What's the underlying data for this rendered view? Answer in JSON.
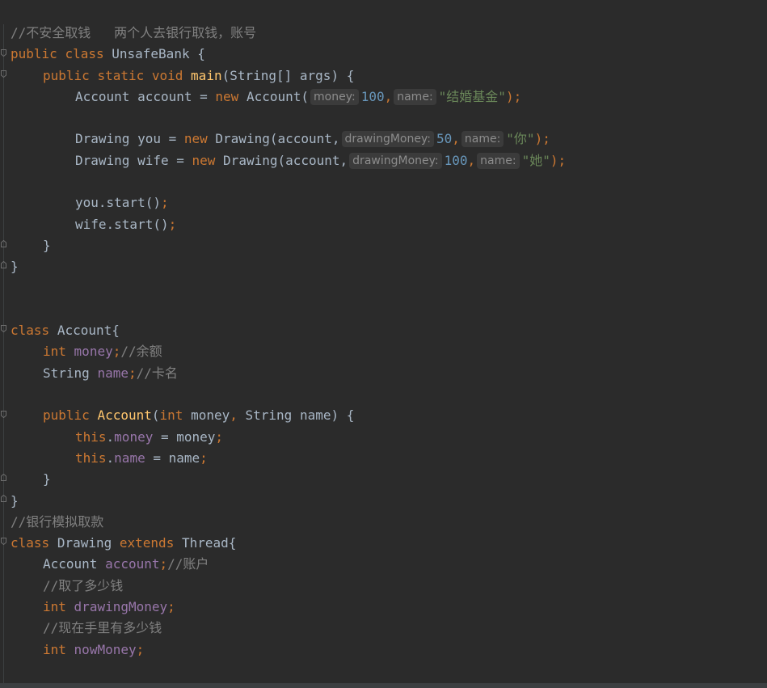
{
  "editor": {
    "l1": {
      "comment": "//不安全取钱   两个人去银行取钱，账号"
    },
    "l2": {
      "kw_public": "public",
      "kw_class": "class",
      "class_name": "UnsafeBank",
      "brace": "{"
    },
    "l3": {
      "kw_public": "public",
      "kw_static": "static",
      "kw_void": "void",
      "method": "main",
      "params": "(String[] args) {"
    },
    "l4": {
      "left": "Account account = ",
      "kw_new": "new",
      "ctor": "Account(",
      "hint_money": "money:",
      "money": "100",
      "comma": ",",
      "hint_name": "name:",
      "name": "\"结婚基金\"",
      "end": ");"
    },
    "l6": {
      "left": "Drawing you = ",
      "kw_new": "new",
      "ctor": "Drawing(account,",
      "hint_drawing": "drawingMoney:",
      "drawing": "50",
      "comma": ",",
      "hint_name": "name:",
      "name": "\"你\"",
      "end": ");"
    },
    "l7": {
      "left": "Drawing wife = ",
      "kw_new": "new",
      "ctor": "Drawing(account,",
      "hint_drawing": "drawingMoney:",
      "drawing": "100",
      "comma": ",",
      "hint_name": "name:",
      "name": "\"她\"",
      "end": ");"
    },
    "l9": {
      "text": "you.start()",
      "semi": ";"
    },
    "l10": {
      "text": "wife.start()",
      "semi": ";"
    },
    "l11": {
      "text": "}"
    },
    "l12": {
      "text": "}"
    },
    "l15": {
      "kw_class": "class",
      "text": "Account{"
    },
    "l16": {
      "kw_int": "int",
      "field": "money",
      "semi": ";",
      "comment": "//余额"
    },
    "l17": {
      "type": "String",
      "field": "name",
      "semi": ";",
      "comment": "//卡名"
    },
    "l19": {
      "kw_public": "public",
      "ctor": "Account",
      "p_open": "(",
      "kw_int": "int",
      "p_money": "money",
      "comma": ",",
      "p_rest": "String name) {"
    },
    "l20": {
      "kw_this": "this",
      "dot": ".",
      "field": "money",
      "rest": " = money",
      "semi": ";"
    },
    "l21": {
      "kw_this": "this",
      "dot": ".",
      "field": "name",
      "rest": " = name",
      "semi": ";"
    },
    "l22": {
      "text": "}"
    },
    "l23": {
      "text": "}"
    },
    "l24": {
      "comment": "//银行模拟取款"
    },
    "l25": {
      "kw_class": "class",
      "class_name": "Drawing",
      "kw_extends": "extends",
      "parent": "Thread{"
    },
    "l26": {
      "type": "Account",
      "field": "account",
      "semi": ";",
      "comment": "//账户"
    },
    "l27": {
      "comment": "//取了多少钱"
    },
    "l28": {
      "kw_int": "int",
      "field": "drawingMoney",
      "semi": ";"
    },
    "l29": {
      "comment": "//现在手里有多少钱"
    },
    "l30": {
      "kw_int": "int",
      "field": "nowMoney",
      "semi": ";"
    }
  },
  "colors": {
    "background": "#2b2b2b",
    "keyword": "#cc7832",
    "method": "#ffc66d",
    "number": "#6897bb",
    "string": "#6a8759",
    "field": "#9876aa",
    "comment": "#808080",
    "text": "#a9b7c6"
  },
  "icons": {
    "fold_marker": "fold-marker-icon"
  }
}
